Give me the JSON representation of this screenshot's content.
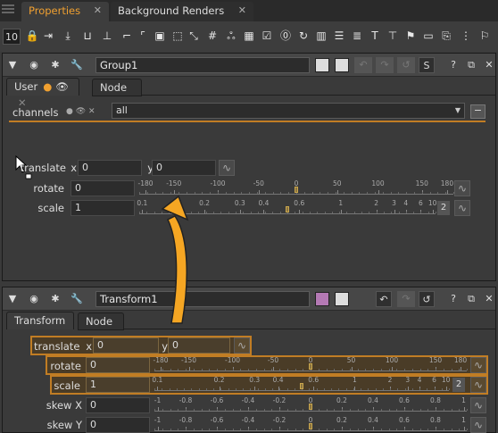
{
  "tabs": [
    {
      "label": "Properties",
      "close": "✕"
    },
    {
      "label": "Background Renders",
      "close": "✕"
    }
  ],
  "toolbar": {
    "max_panels": "10",
    "icons": [
      "lock-icon",
      "transform-input-icon",
      "export-icon",
      "rename-icon",
      "axis-icon",
      "knob-link-icon",
      "crop-icon",
      "box-icon",
      "bbox-icon",
      "hash-icon",
      "color-circles-icon",
      "grid-icon",
      "checkbox-icon",
      "number-icon",
      "loop-icon",
      "arrange-icon",
      "list-icon",
      "sort-icon",
      "text-tool-icon",
      "text-box-icon",
      "flag-icon",
      "image-icon",
      "file-icon",
      "slider-icon",
      "flag-row-icon"
    ]
  },
  "group1": {
    "name": "Group1",
    "tabs": [
      "User",
      "Node"
    ],
    "channels_label": "channels",
    "channels_value": "all",
    "translate_label": "translate",
    "x_label": "x",
    "y_label": "y",
    "translate_x": "0",
    "translate_y": "0",
    "rotate_label": "rotate",
    "rotate_value": "0",
    "scale_label": "scale",
    "scale_value": "1",
    "scale_count": "2",
    "rotate_ticks": [
      "-180",
      "-150",
      "-100",
      "-50",
      "0",
      "50",
      "100",
      "150",
      "180"
    ],
    "scale_ticks": [
      "0.1",
      "0.2",
      "0.3",
      "0.4",
      "0.6",
      "1",
      "2",
      "3",
      "4",
      "6",
      "10"
    ]
  },
  "transform1": {
    "name": "Transform1",
    "tabs": [
      "Transform",
      "Node"
    ],
    "translate_label": "translate",
    "x_label": "x",
    "y_label": "y",
    "translate_x": "0",
    "translate_y": "0",
    "rotate_label": "rotate",
    "rotate_value": "0",
    "scale_label": "scale",
    "scale_value": "1",
    "scale_count": "2",
    "skewx_label": "skew X",
    "skewx_value": "0",
    "skewy_label": "skew Y",
    "skewy_value": "0",
    "rotate_ticks": [
      "-180",
      "-150",
      "-100",
      "-50",
      "0",
      "50",
      "100",
      "150",
      "180"
    ],
    "scale_ticks": [
      "0.1",
      "0.2",
      "0.3",
      "0.4",
      "0.6",
      "1",
      "2",
      "3",
      "4",
      "6",
      "10"
    ],
    "skew_ticks": [
      "-1",
      "-0.8",
      "-0.6",
      "-0.4",
      "-0.2",
      "0",
      "0.2",
      "0.4",
      "0.6",
      "0.8",
      "1"
    ]
  },
  "header_buttons": {
    "help": "?",
    "float": "⧉",
    "close": "✕",
    "s": "S"
  },
  "colors": {
    "accent": "#f0a030",
    "arrow": "#f5a623",
    "highlight": "#c17d24"
  }
}
